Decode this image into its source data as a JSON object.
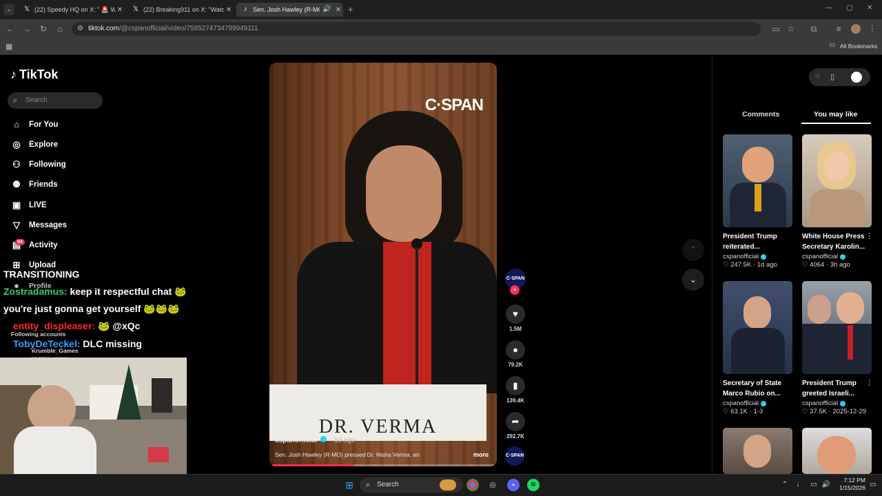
{
  "browser": {
    "tabs": [
      {
        "title": "(22) Speedy HQ on X: \" 🚨 WA",
        "icon": "x-logo-icon",
        "active": false
      },
      {
        "title": "(22) Breaking911 on X: \"Watch",
        "icon": "x-logo-icon",
        "active": false
      },
      {
        "title": "Sen. Josh Hawley (R-MO) p",
        "icon": "tiktok-icon",
        "active": true
      }
    ],
    "url_host": "tiktok.com",
    "url_path": "/@cspanofficial/video/7595274734799949111",
    "bookmarks_label": "All Bookmarks"
  },
  "tiktok": {
    "logo": "TikTok",
    "search_placeholder": "Search",
    "nav": [
      {
        "label": "For You",
        "icon": "home-icon"
      },
      {
        "label": "Explore",
        "icon": "compass-icon"
      },
      {
        "label": "Following",
        "icon": "following-icon"
      },
      {
        "label": "Friends",
        "icon": "friends-icon"
      },
      {
        "label": "LIVE",
        "icon": "live-icon"
      },
      {
        "label": "Messages",
        "icon": "messages-icon"
      },
      {
        "label": "Activity",
        "icon": "activity-icon"
      },
      {
        "label": "Upload",
        "icon": "upload-icon"
      },
      {
        "label": "Profile",
        "icon": "profile-icon"
      }
    ],
    "activity_badge": "94",
    "following_accounts_label": "Following accounts",
    "following_account": "Krumble_Games",
    "following_account_handle": "krumble_games"
  },
  "chat": {
    "header": "TRANSITIONING",
    "lines": [
      {
        "user": "Zostradamus:",
        "text": "keep it respectful chat 🐸",
        "color": "#35d06a"
      },
      {
        "user": "",
        "text": "you're just gonna get yourself 🐸🐸🐸",
        "color": "#ffffff"
      },
      {
        "user": "entity_displeaser:",
        "text": "🐸 @xQc",
        "color": "#ff2a2a"
      },
      {
        "user": "TobyDeTeckel:",
        "text": "DLC missing",
        "color": "#3aa0ff"
      }
    ]
  },
  "video": {
    "watermark": "C·SPAN",
    "nameplate": "DR. VERMA",
    "author": "cspanofficial",
    "time_ago": "· 1d ago",
    "caption": "Sen. Josh Hawley (R-MO) pressed Dr. Nisha Verma, an",
    "more": "more",
    "progress": 0.37
  },
  "actions": {
    "avatar_label": "C·SPAN",
    "likes": "1.5M",
    "comments": "79.2K",
    "saves": "139.4K",
    "shares": "292.7K"
  },
  "right_panel": {
    "tabs": [
      "Comments",
      "You may like"
    ],
    "active_tab": "You may like",
    "cards": [
      {
        "title": "President Trump reiterated...",
        "author": "cspanofficial",
        "likes": "247.5K",
        "ago": "1d ago",
        "thumb": "#30404f"
      },
      {
        "title": "White House Press Secretary Karolin...",
        "author": "cspanofficial",
        "likes": "4064",
        "ago": "3h ago",
        "thumb": "#b9a48c"
      },
      {
        "title": "Secretary of State Marco Rubio on...",
        "author": "cspanofficial",
        "likes": "63.1K",
        "ago": "1-3",
        "thumb": "#3c4a66"
      },
      {
        "title": "President Trump greeted Israeli...",
        "author": "cspanofficial",
        "likes": "37.5K",
        "ago": "2025-12-29",
        "thumb": "#5a6270"
      },
      {
        "title": "",
        "author": "",
        "likes": "",
        "ago": "",
        "thumb": "#7d6a60"
      },
      {
        "title": "",
        "author": "",
        "likes": "",
        "ago": "",
        "thumb": "#c28a6e"
      }
    ]
  },
  "taskbar": {
    "search": "Search",
    "time": "7:12 PM",
    "date": "1/15/2026"
  }
}
